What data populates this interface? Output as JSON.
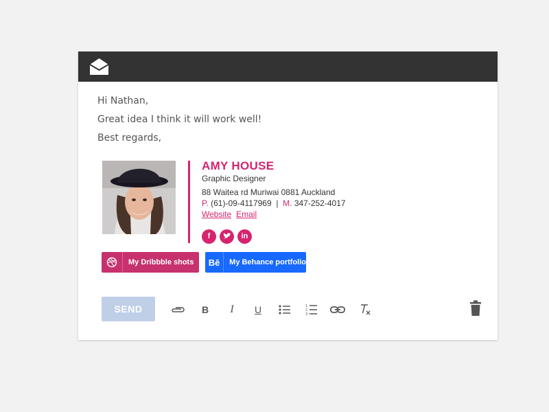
{
  "email": {
    "greeting": "Hi Nathan,",
    "message": "Great idea I think it will work well!",
    "closing": "Best regards,"
  },
  "signature": {
    "name": "AMY HOUSE",
    "title": "Graphic Designer",
    "address": "88 Waitea rd Muriwai 0881 Auckland",
    "phone_label": "P.",
    "phone": "(61)-09-4117969",
    "separator": "|",
    "mobile_label": "M.",
    "mobile": "347-252-4017",
    "links": [
      "Website",
      "Email"
    ],
    "social_icons": [
      "facebook-icon",
      "twitter-icon",
      "linkedin-icon"
    ],
    "accent_color": "#d6246e"
  },
  "badges": [
    {
      "label": "My Dribbble shots",
      "icon": "dribbble-icon",
      "color": "#c7316d"
    },
    {
      "label": "My Behance portfolio",
      "icon": "behance-icon",
      "icon_text": "Bē",
      "color": "#1769ff"
    }
  ],
  "toolbar": {
    "send_label": "SEND",
    "tools": [
      "attach-icon",
      "bold-icon",
      "italic-icon",
      "underline-icon",
      "bulleted-list-icon",
      "numbered-list-icon",
      "link-icon",
      "clear-format-icon"
    ],
    "bold": "B",
    "italic": "I",
    "underline": "U"
  }
}
